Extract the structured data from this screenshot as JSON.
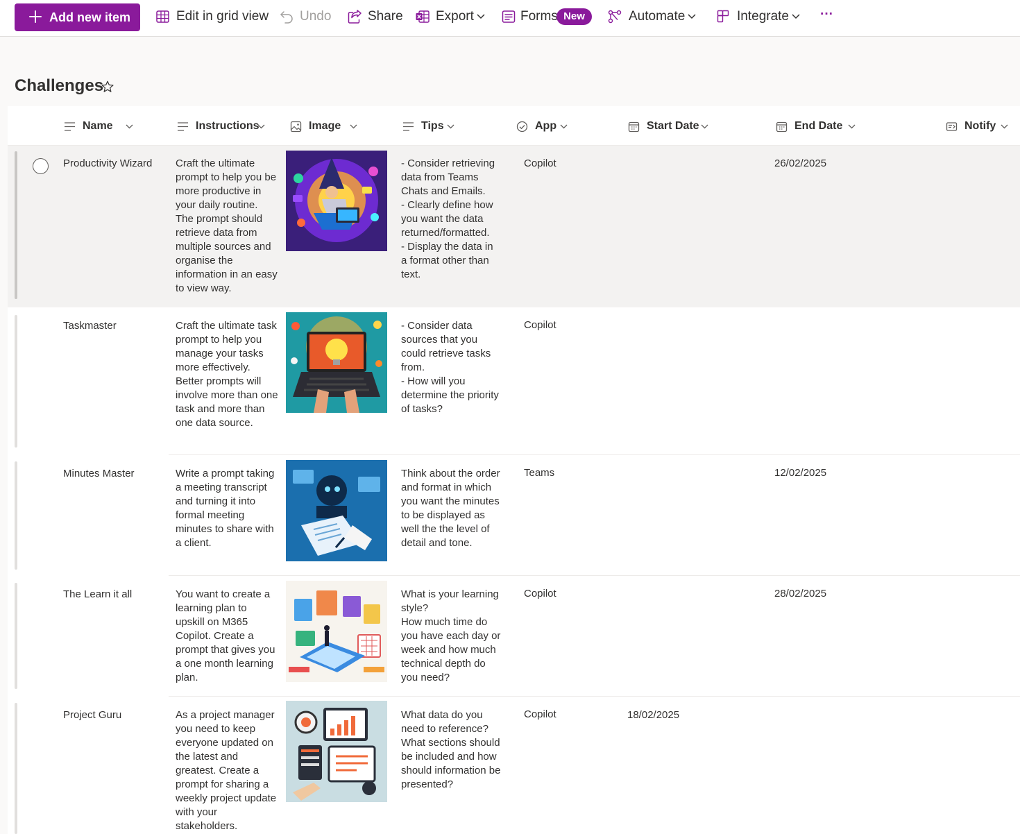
{
  "toolbar": {
    "add_label": "Add new item",
    "grid_label": "Edit in grid view",
    "undo_label": "Undo",
    "share_label": "Share",
    "export_label": "Export",
    "forms_label": "Forms",
    "forms_badge": "New",
    "automate_label": "Automate",
    "integrate_label": "Integrate",
    "more_label": "···"
  },
  "list": {
    "title": "Challenges",
    "columns": {
      "name": "Name",
      "instructions": "Instructions",
      "image": "Image",
      "tips": "Tips",
      "app": "App",
      "start": "Start Date",
      "end": "End Date",
      "notify": "Notify"
    },
    "rows": [
      {
        "name": "Productivity Wizard",
        "instructions": "Craft the ultimate prompt to help you be more productive in your daily routine. The prompt should retrieve data from multiple sources and organise the information in an easy to view way.",
        "tips": "- Consider retrieving data from Teams Chats and Emails.\n- Clearly define how you want the data returned/formatted.\n- Display the data in a format other than text.",
        "app": "Copilot",
        "start": "",
        "end": "26/02/2025",
        "image": "wizard-laptop-illustration"
      },
      {
        "name": "Taskmaster",
        "instructions": "Craft the ultimate task prompt to help you manage your tasks more effectively. Better prompts will involve more than one task and more than one data source.",
        "tips": "- Consider data sources that you could retrieve tasks from.\n- How will you determine the priority of tasks?",
        "app": "Copilot",
        "start": "",
        "end": "",
        "image": "laptop-lightbulb-illustration"
      },
      {
        "name": "Minutes Master",
        "instructions": "Write a prompt taking a meeting transcript and turning it into formal meeting minutes to share with a client.",
        "tips": "Think about the order and format in which you want the minutes to be displayed as well the the level of detail and tone.",
        "app": "Teams",
        "start": "",
        "end": "12/02/2025",
        "image": "ai-robot-writing-illustration"
      },
      {
        "name": "The Learn it all",
        "instructions": "You want to create a learning plan to upskill on M365 Copilot. Create a prompt that gives you a one month learning plan.",
        "tips": "What is your learning style?\nHow much time do you have each day or week and how much technical depth do you need?",
        "app": "Copilot",
        "start": "",
        "end": "28/02/2025",
        "image": "learning-plan-illustration"
      },
      {
        "name": "Project Guru",
        "instructions": "As a project manager you need to keep everyone updated on the latest and greatest. Create a prompt for sharing a weekly project update with your stakeholders.",
        "tips": "What data do you need to reference? What sections should be included and how should information be presented?",
        "app": "Copilot",
        "start": "18/02/2025",
        "end": "",
        "image": "project-dashboard-illustration"
      }
    ]
  },
  "colors": {
    "brand": "#8a1a9b",
    "text": "#323130",
    "muted": "#a19f9d",
    "selected_row": "#f3f2f1"
  }
}
